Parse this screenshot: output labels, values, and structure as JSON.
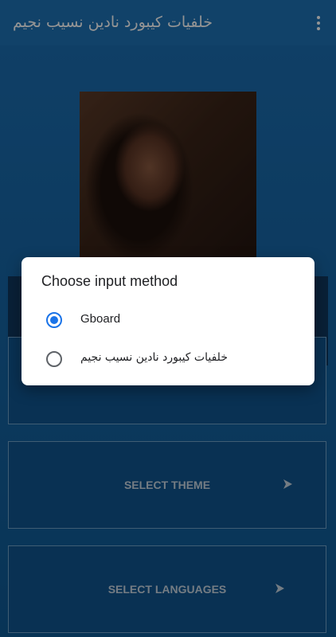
{
  "app_bar": {
    "title": "خلفيات كيبورد نادين نسيب نجيم",
    "menu_icon": "more-vert-icon",
    "color": "#1e73b6"
  },
  "menu": {
    "items": [
      {
        "label": "",
        "icon": ""
      },
      {
        "label": "SELECT THEME",
        "icon": "arrow-right-icon"
      },
      {
        "label": "SELECT LANGUAGES",
        "icon": "arrow-right-icon"
      }
    ]
  },
  "dialog": {
    "title": "Choose input method",
    "options": [
      {
        "label": "Gboard",
        "selected": true
      },
      {
        "label": "خلفيات كيبورد نادين نسيب نجيم",
        "selected": false
      }
    ],
    "accent": "#1a73e8"
  }
}
